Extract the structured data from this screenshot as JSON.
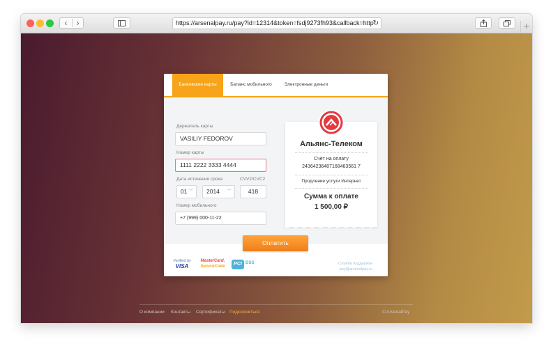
{
  "browser": {
    "url": "https://arsenalpay.ru/pay?id=12314&token=fsdj9273fh93&callback=http",
    "reload_icon": "↻",
    "new_tab_icon": "+"
  },
  "tabs": [
    {
      "label": "Банковские карты",
      "active": true
    },
    {
      "label": "Баланс мобильного",
      "active": false
    },
    {
      "label": "Электронные деньги",
      "active": false
    }
  ],
  "form": {
    "holder_label": "Держатель карты",
    "holder_value": "VASILIY FEDOROV",
    "card_label": "Номер карты",
    "card_value": "1111  2222  3333  4444",
    "expiry_label": "Дата истечения срока",
    "month_value": "01",
    "year_value": "2014",
    "cvv_label": "CVV2/CVC2",
    "cvv_value": "418",
    "phone_label": "Номер мобильного",
    "phone_value": "+7 (999) 000-11-22"
  },
  "receipt": {
    "merchant": "Альянс-Телеком",
    "invoice_label": "Счёт на оплату",
    "invoice_number": "24364236487168463561 7",
    "service": "Продление услуги Интернет",
    "amount_label": "Сумма к оплате",
    "amount": "1 500,00 ₽"
  },
  "pay_button": "Оплатить",
  "badges": {
    "visa_top": "Verified by",
    "visa_bottom": "VISA",
    "mc_top": "MasterCard.",
    "mc_bottom": "SecureCode",
    "pci": "PCI",
    "pci_dss": "DSS"
  },
  "support": {
    "label": "Служба поддержки",
    "email": "pay@arsenalpay.ru"
  },
  "footer": {
    "links": [
      "О компании",
      "Контакты",
      "Сертификаты",
      "Подключиться"
    ],
    "copyright": "© ArsenalPay"
  },
  "colors": {
    "accent": "#f7a41a",
    "logo_red": "#e5383f",
    "error_border": "#ec6f7d",
    "highlight_link": "#f2b13a"
  }
}
